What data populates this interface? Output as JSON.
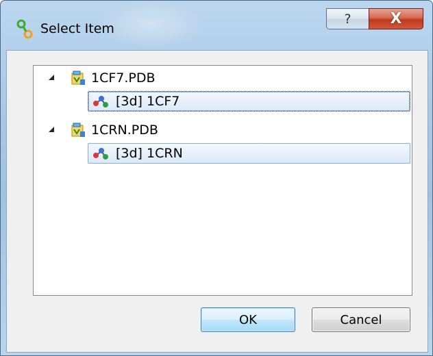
{
  "window": {
    "title": "Select Item",
    "help_label": "?",
    "close_label": "X"
  },
  "tree": {
    "items": [
      {
        "label": "1CF7.PDB",
        "icon": "pdb-file-icon",
        "expanded": true,
        "children": [
          {
            "label": "[3d] 1CF7",
            "icon": "molecule-icon",
            "focused": true
          }
        ]
      },
      {
        "label": "1CRN.PDB",
        "icon": "pdb-file-icon",
        "expanded": true,
        "children": [
          {
            "label": "[3d] 1CRN",
            "icon": "molecule-icon",
            "focused": false
          }
        ]
      }
    ]
  },
  "buttons": {
    "ok_label": "OK",
    "cancel_label": "Cancel"
  },
  "colors": {
    "selection_border": "#84acdd",
    "close_red": "#c0391d",
    "ok_accent": "#3c7fb1"
  }
}
